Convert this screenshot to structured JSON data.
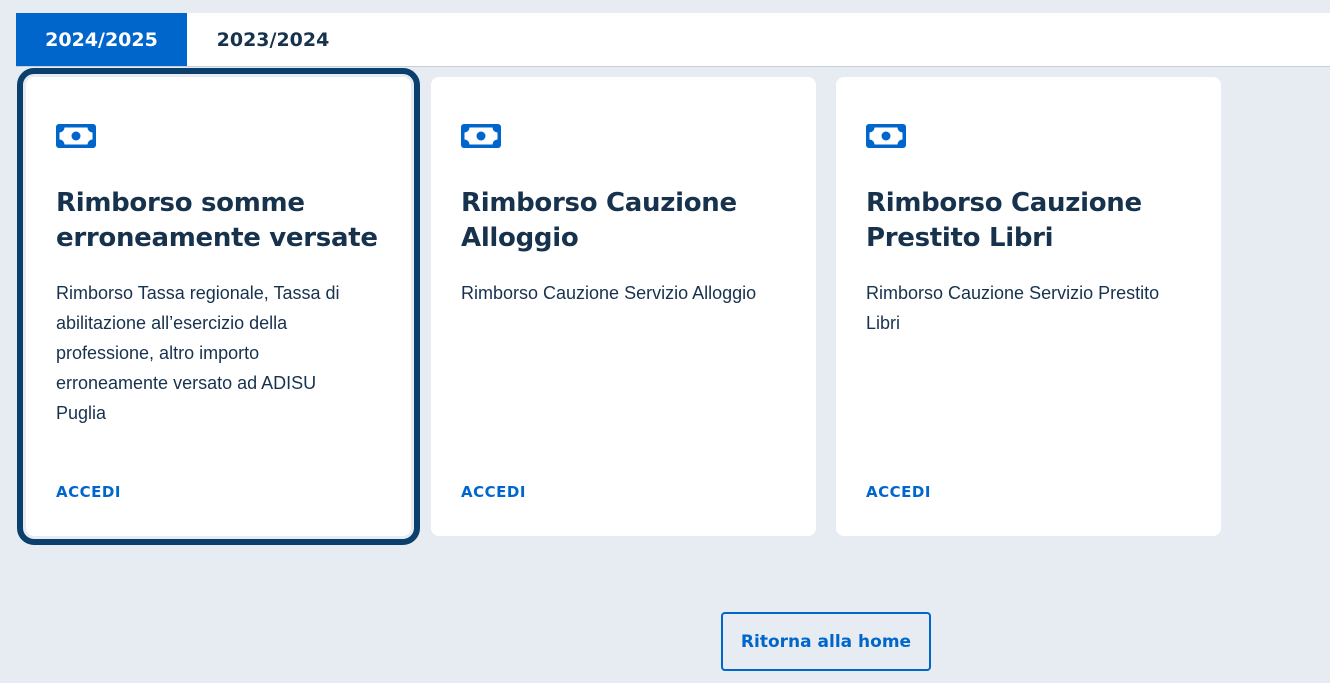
{
  "tabs": [
    {
      "label": "2024/2025",
      "active": true
    },
    {
      "label": "2023/2024",
      "active": false
    }
  ],
  "cards": [
    {
      "icon": "money-bill-icon",
      "title": "Rimborso somme erroneamente versate",
      "description": "Rimborso Tassa regionale, Tassa di abilitazione all’esercizio della professione, altro importo erroneamente versato ad ADISU Puglia",
      "link": "ACCEDI"
    },
    {
      "icon": "money-bill-icon",
      "title": "Rimborso Cauzione Alloggio",
      "description": "Rimborso Cauzione Servizio Alloggio",
      "link": "ACCEDI"
    },
    {
      "icon": "money-bill-icon",
      "title": "Rimborso Cauzione Prestito Libri",
      "description": "Rimborso Cauzione Servizio Prestito Libri",
      "link": "ACCEDI"
    }
  ],
  "home_button": {
    "label": "Ritorna alla home"
  },
  "colors": {
    "accent": "#0066cc",
    "text": "#17324d",
    "background": "#e6ecf2",
    "focus_outline": "#0b3f6e"
  }
}
